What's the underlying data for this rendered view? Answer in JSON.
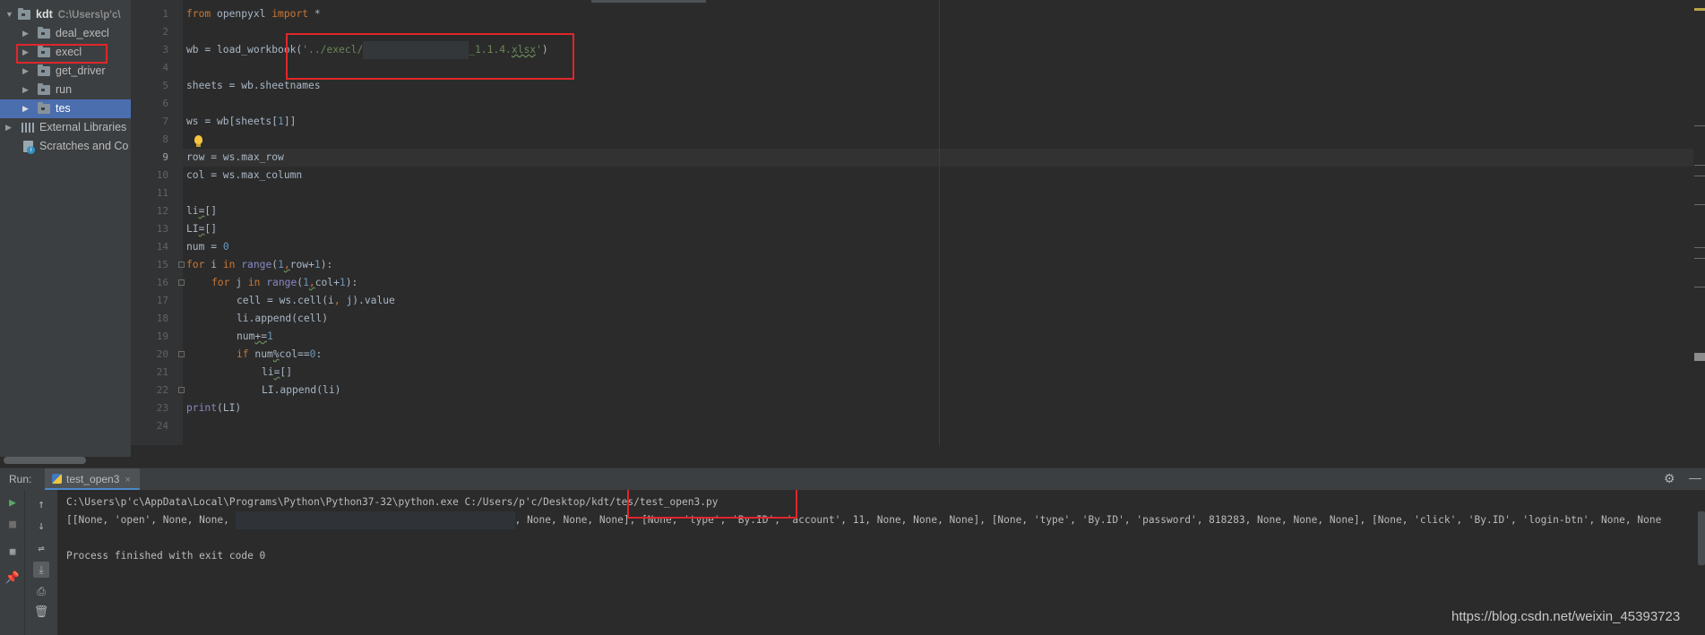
{
  "project_tree": {
    "root": {
      "name": "kdt",
      "path": "C:\\Users\\p'c\\"
    },
    "folders": [
      "deal_execl",
      "execl",
      "get_driver",
      "run",
      "tes"
    ],
    "selected": "tes",
    "external_libraries": "External Libraries",
    "scratches": "Scratches and Co"
  },
  "editor": {
    "current_line": 9,
    "line_numbers": [
      "1",
      "2",
      "3",
      "4",
      "5",
      "6",
      "7",
      "8",
      "9",
      "10",
      "11",
      "12",
      "13",
      "14",
      "15",
      "16",
      "17",
      "18",
      "19",
      "20",
      "21",
      "22",
      "23",
      "24"
    ],
    "code": {
      "l1_from": "from",
      "l1_mod": " openpyxl ",
      "l1_import": "import",
      "l1_star": " *",
      "l3_a": "wb = load_workbook(",
      "l3_str1": "'../execl/",
      "l3_str2": "_1.1.4.",
      "l3_ext": "xlsx",
      "l3_q": "'",
      "l3_close": ")",
      "l5": "sheets = wb.sheetnames",
      "l7_a": "ws = wb[sheets[",
      "l7_n": "1",
      "l7_b": "]]",
      "l9": "row = ws.max_row",
      "l10": "col = ws.max_column",
      "l12_a": "li",
      "l12_eq": "=",
      "l12_b": "[]",
      "l13_a": "LI",
      "l13_eq": "=",
      "l13_b": "[]",
      "l14_a": "num = ",
      "l14_n": "0",
      "l15_for": "for",
      "l15_a": " i ",
      "l15_in": "in",
      "l15_sp": " ",
      "l15_range": "range",
      "l15_p": "(",
      "l15_one": "1",
      "l15_c": ",",
      "l15_b": "row+",
      "l15_one2": "1",
      "l15_e": "):",
      "l16_for": "for",
      "l16_a": " j ",
      "l16_in": "in",
      "l16_sp": " ",
      "l16_range": "range",
      "l16_p": "(",
      "l16_one": "1",
      "l16_c": ",",
      "l16_b": "col+",
      "l16_one2": "1",
      "l16_e": "):",
      "l17_a": "cell = ws.cell(i",
      "l17_c": ",",
      "l17_b": " j).value",
      "l18": "li.append(cell)",
      "l19_a": "num",
      "l19_op": "+=",
      "l19_n": "1",
      "l20_if": "if",
      "l20_a": " num",
      "l20_op": "%",
      "l20_b": "col",
      "l20_eq": "==",
      "l20_n": "0",
      "l20_e": ":",
      "l21_a": "li",
      "l21_eq": "=",
      "l21_b": "[]",
      "l22": "LI.append(li)",
      "l23_print": "print",
      "l23_b": "(LI)"
    }
  },
  "run": {
    "title": "Run:",
    "tab_label": "test_open3",
    "tab_close": "×",
    "cmd_a": "C:\\Users\\p'c\\AppData\\Local\\Programs\\Python\\Python37-32\\python.exe C:/Users/p'c/Desktop/kdt",
    "cmd_b": "/tes/test_open3.py",
    "out_a": "[[None, 'open', None, None, ",
    "out_b": ", None, None, None], [None, 'type', 'By.ID', 'account', 11, None, None, None], [None, 'type', 'By.ID', 'password', 818283, None, None, None], [None, 'click', 'By.ID', 'login-btn', None, None",
    "finished": "Process finished with exit code 0"
  },
  "watermark": "https://blog.csdn.net/weixin_45393723",
  "colors": {
    "highlight_box": "#e0262a",
    "selection": "#4b6eaf",
    "keyword": "#cc7832",
    "string": "#6a8759",
    "number": "#6897bb"
  }
}
